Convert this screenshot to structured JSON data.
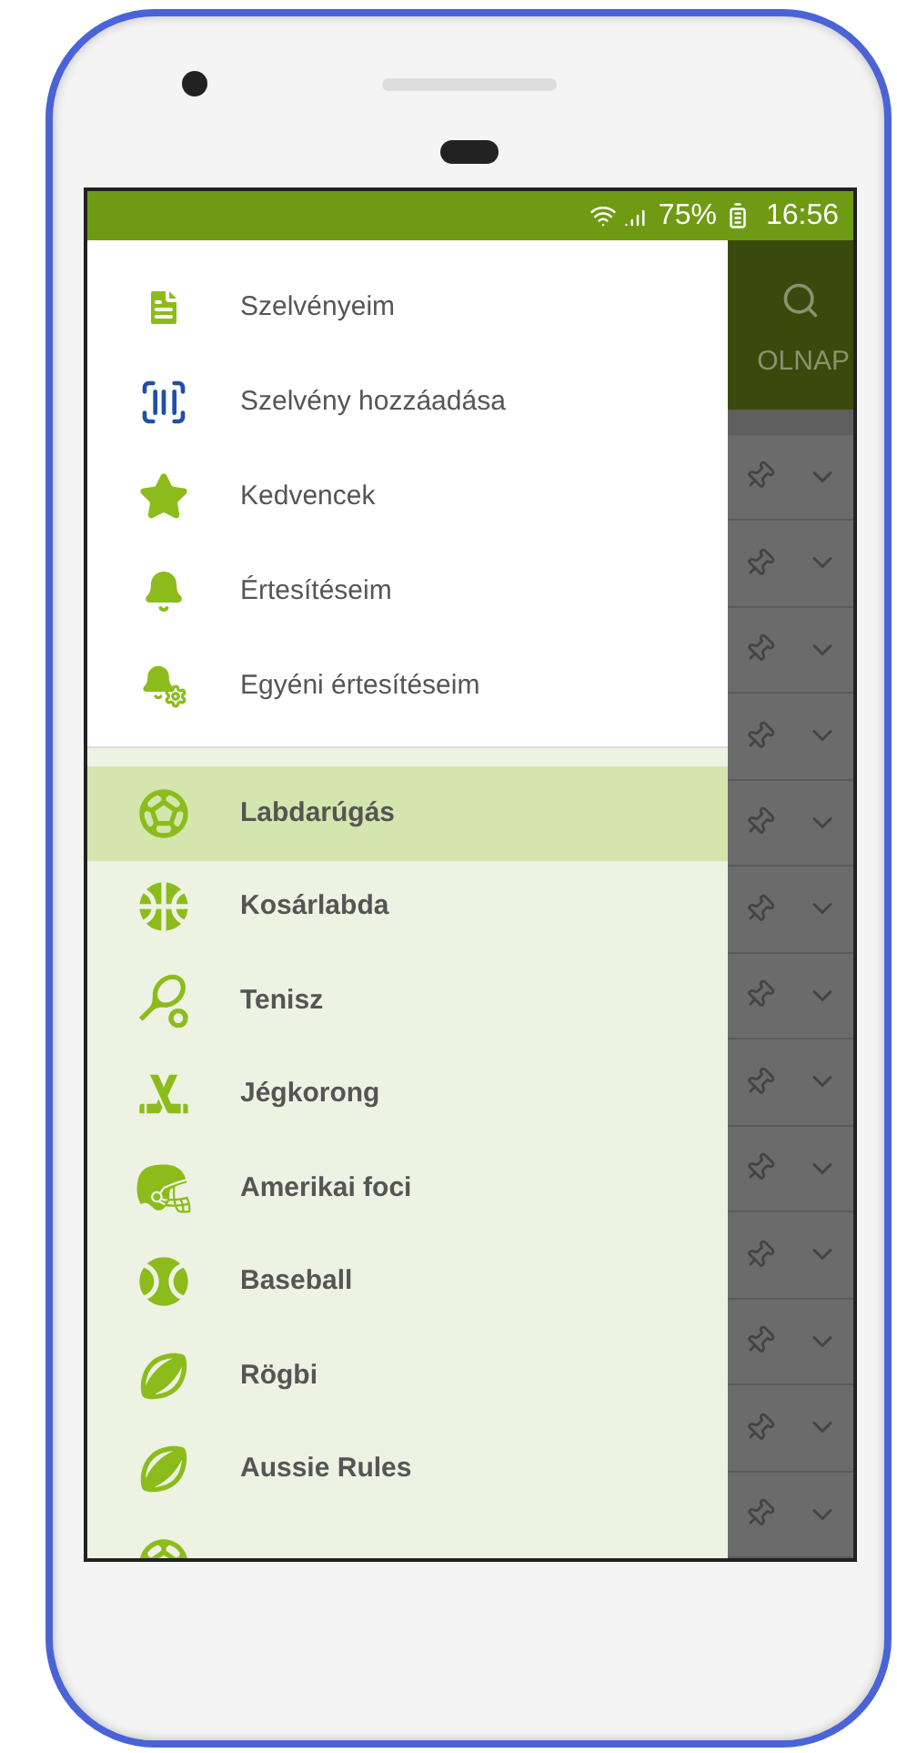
{
  "status_bar": {
    "battery": "75%",
    "time": "16:56"
  },
  "app_bar": {
    "tab_label": "OLNAP"
  },
  "menu": [
    {
      "label": "Szelvényeim"
    },
    {
      "label": "Szelvény hozzáadása"
    },
    {
      "label": "Kedvencek"
    },
    {
      "label": "Értesítéseim"
    },
    {
      "label": "Egyéni értesítéseim"
    }
  ],
  "sports": [
    {
      "label": "Labdarúgás",
      "selected": true
    },
    {
      "label": "Kosárlabda",
      "selected": false
    },
    {
      "label": "Tenisz",
      "selected": false
    },
    {
      "label": "Jégkorong",
      "selected": false
    },
    {
      "label": "Amerikai foci",
      "selected": false
    },
    {
      "label": "Baseball",
      "selected": false
    },
    {
      "label": "Rögbi",
      "selected": false
    },
    {
      "label": "Aussie Rules",
      "selected": false
    },
    {
      "selected": false
    }
  ]
}
